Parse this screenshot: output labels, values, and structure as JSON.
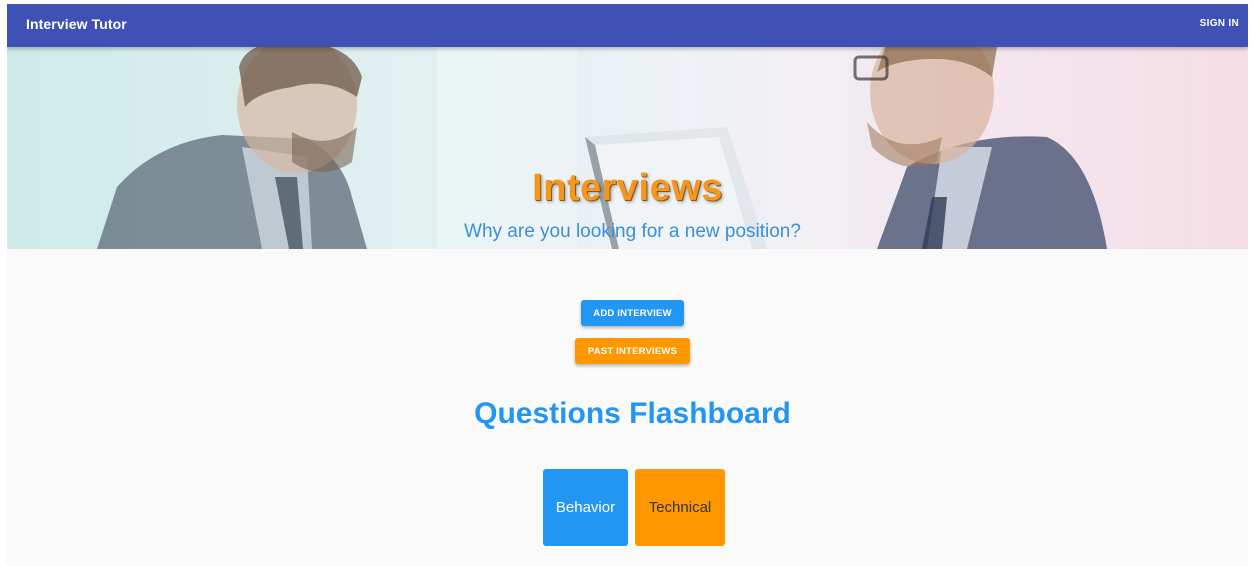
{
  "appbar": {
    "title": "Interview Tutor",
    "signin_label": "SIGN IN"
  },
  "hero": {
    "title": "Interviews",
    "subtitle": "Why are you looking for a new position?"
  },
  "actions": {
    "add_label": "ADD INTERVIEW",
    "past_label": "PAST INTERVIEWS"
  },
  "flashboard": {
    "title": "Questions Flashboard",
    "cards": [
      {
        "label": "Behavior"
      },
      {
        "label": "Technical"
      }
    ]
  },
  "colors": {
    "appbar": "#3f51b5",
    "primary": "#2196f3",
    "accent": "#ff9800",
    "hero_title": "#f6961f",
    "hero_subtitle": "#3a8fd8"
  },
  "icons": {
    "hero_image": "interview-photo"
  }
}
